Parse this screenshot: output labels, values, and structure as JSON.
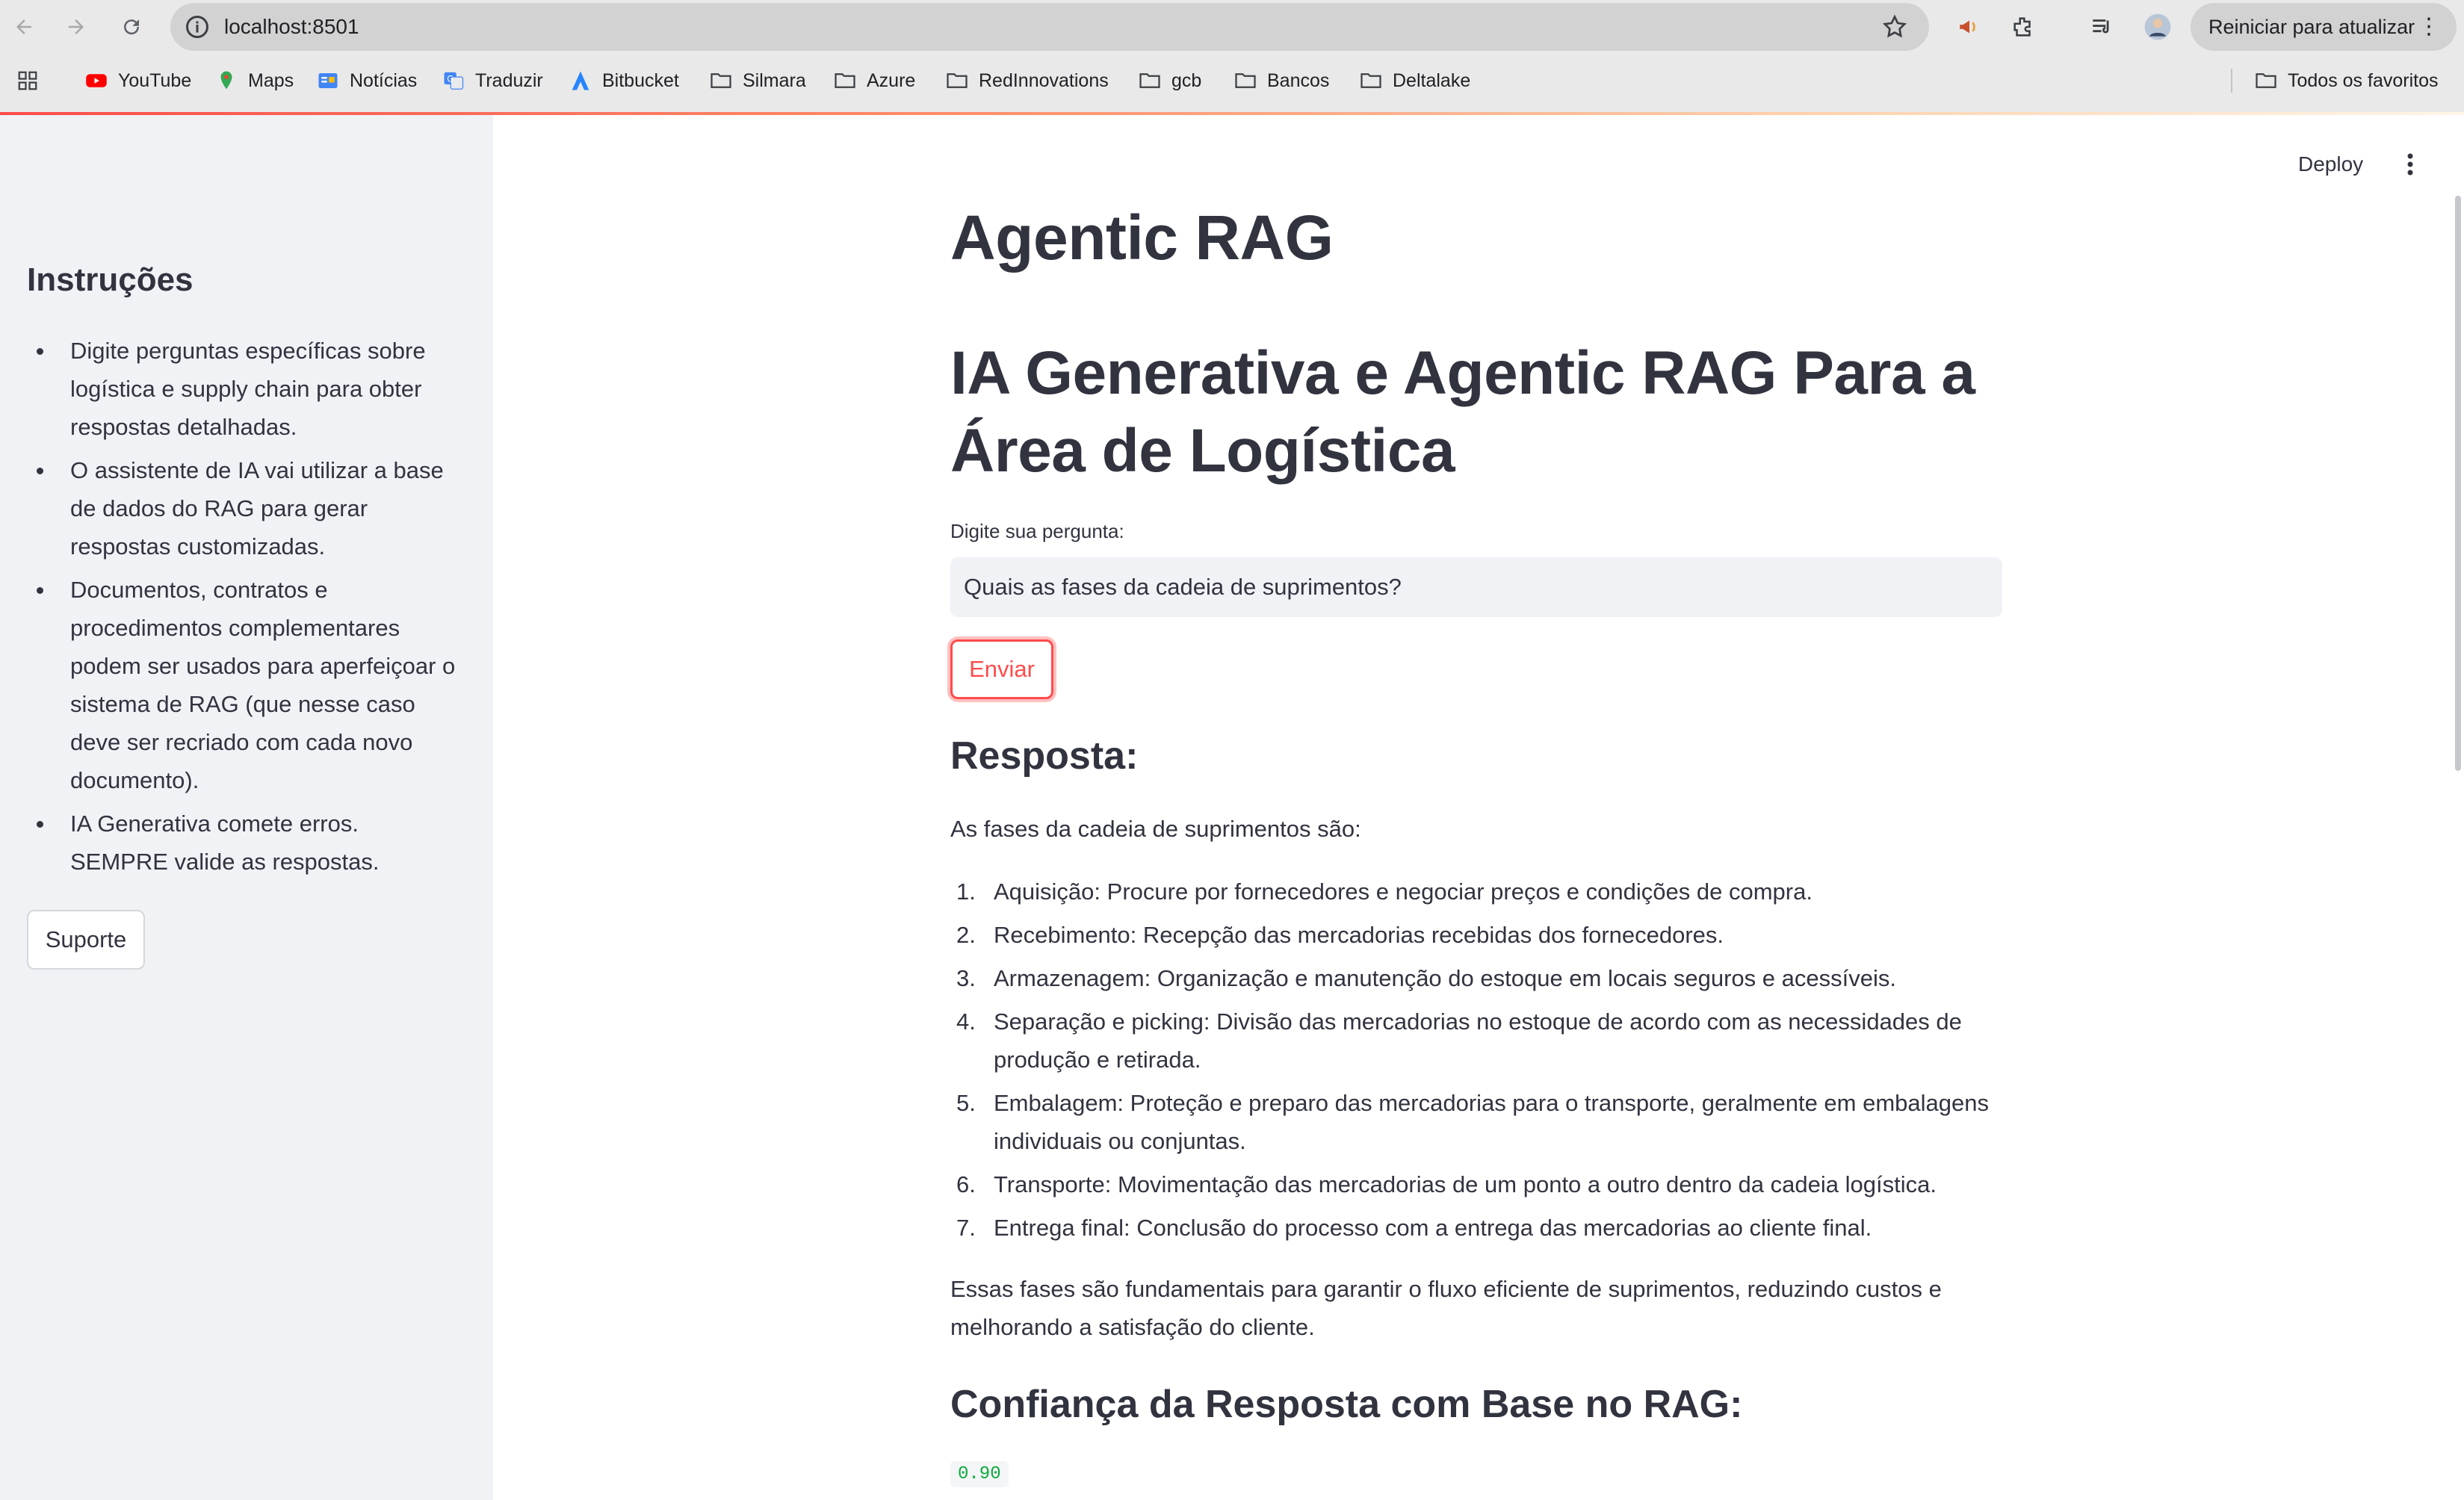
{
  "browser": {
    "url": "localhost:8501",
    "relaunch_label": "Reiniciar para atualizar",
    "bookmarks": [
      {
        "label": "YouTube",
        "icon": "youtube-icon"
      },
      {
        "label": "Maps",
        "icon": "maps-icon"
      },
      {
        "label": "Notícias",
        "icon": "news-icon"
      },
      {
        "label": "Traduzir",
        "icon": "translate-icon"
      },
      {
        "label": "Bitbucket",
        "icon": "bitbucket-icon"
      },
      {
        "label": "Silmara",
        "icon": "folder-icon"
      },
      {
        "label": "Azure",
        "icon": "folder-icon"
      },
      {
        "label": "RedInnovations",
        "icon": "folder-icon"
      },
      {
        "label": "gcb",
        "icon": "folder-icon"
      },
      {
        "label": "Bancos",
        "icon": "folder-icon"
      },
      {
        "label": "Deltalake",
        "icon": "folder-icon"
      }
    ],
    "all_bookmarks_label": "Todos os favoritos"
  },
  "sidebar": {
    "title": "Instruções",
    "items": [
      {
        "text": "Digite perguntas específicas sobre logística e supply chain para obter respostas detalhadas."
      },
      {
        "text": "O assistente de IA vai utilizar a base de dados do RAG para gerar respostas customizadas."
      },
      {
        "text": "Documentos, contratos e procedimentos complementares podem ser usados para aperfeiçoar o sistema de RAG (que nesse caso deve ser recriado com cada novo documento)."
      },
      {
        "text": "IA Generativa comete erros. SEMPRE valide as respostas."
      }
    ],
    "support_label": "Suporte"
  },
  "header": {
    "deploy_label": "Deploy"
  },
  "main": {
    "app_title": "Agentic RAG",
    "heading": "IA Generativa e Agentic RAG Para a Área de Logística",
    "question_label": "Digite sua pergunta:",
    "question_value": "Quais as fases da cadeia de suprimentos?",
    "send_label": "Enviar",
    "response_heading": "Resposta:",
    "response_intro": "As fases da cadeia de suprimentos são:",
    "response_items": [
      {
        "num": "1.",
        "text": "Aquisição: Procure por fornecedores e negociar preços e condições de compra."
      },
      {
        "num": "2.",
        "text": "Recebimento: Recepção das mercadorias recebidas dos fornecedores."
      },
      {
        "num": "3.",
        "text": "Armazenagem: Organização e manutenção do estoque em locais seguros e acessíveis."
      },
      {
        "num": "4.",
        "text": "Separação e picking: Divisão das mercadorias no estoque de acordo com as necessidades de produção e retirada."
      },
      {
        "num": "5.",
        "text": "Embalagem: Proteção e preparo das mercadorias para o transporte, geralmente em embalagens individuais ou conjuntas."
      },
      {
        "num": "6.",
        "text": "Transporte: Movimentação das mercadorias de um ponto a outro dentro da cadeia logística."
      },
      {
        "num": "7.",
        "text": "Entrega final: Conclusão do processo com a entrega das mercadorias ao cliente final."
      }
    ],
    "response_outro": "Essas fases são fundamentais para garantir o fluxo eficiente de suprimentos, reduzindo custos e melhorando a satisfação do cliente.",
    "confidence_heading": "Confiança da Resposta com Base no RAG:",
    "confidence_value": "0.90"
  },
  "colors": {
    "accent": "#ff4b4b",
    "sidebar_bg": "#f0f2f6",
    "text": "#31333f",
    "confidence_value": "#09ab3b"
  }
}
